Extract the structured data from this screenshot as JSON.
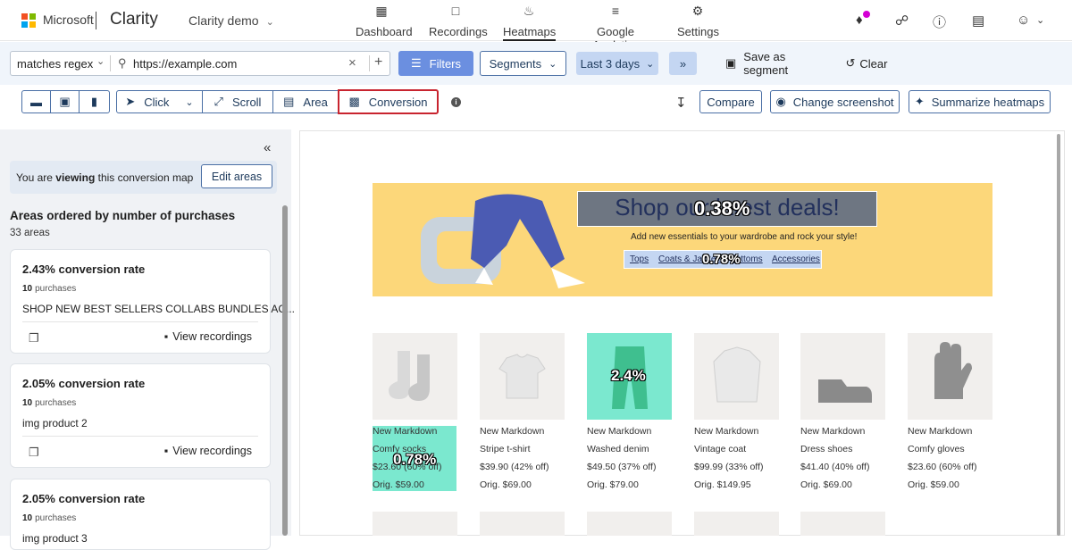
{
  "header": {
    "brand": "Microsoft",
    "product": "Clarity",
    "project": "Clarity demo",
    "tabs": [
      {
        "label": "Dashboard",
        "icon": "dashboard-icon"
      },
      {
        "label": "Recordings",
        "icon": "video-icon"
      },
      {
        "label": "Heatmaps",
        "icon": "flame-icon",
        "active": true
      },
      {
        "label": "Google Analytics",
        "icon": "analytics-icon"
      },
      {
        "label": "Settings",
        "icon": "gear-icon"
      }
    ],
    "right_icons": [
      "bell-icon",
      "share-icon",
      "help-icon",
      "document-icon",
      "account-icon"
    ]
  },
  "filterbar": {
    "match_type": "matches regex",
    "url_value": "https://example.com",
    "filters_label": "Filters",
    "segments_label": "Segments",
    "date_label": "Last 3 days",
    "save_segment_label": "Save as segment",
    "clear_label": "Clear"
  },
  "toolbar": {
    "click_label": "Click",
    "scroll_label": "Scroll",
    "area_label": "Area",
    "conversion_label": "Conversion",
    "compare_label": "Compare",
    "change_screenshot_label": "Change screenshot",
    "summarize_label": "Summarize heatmaps"
  },
  "sidebar": {
    "viewing_prefix": "You are ",
    "viewing_bold": "viewing",
    "viewing_suffix": " this conversion map",
    "edit_areas_label": "Edit areas",
    "areas_title": "Areas ordered by number of purchases",
    "areas_count": "33 areas",
    "view_recordings_label": "View recordings",
    "purchases_word": "purchases",
    "cards": [
      {
        "rate": "2.43% conversion rate",
        "purchases": "10",
        "name": "SHOP NEW BEST SELLERS COLLABS BUNDLES AC..."
      },
      {
        "rate": "2.05% conversion rate",
        "purchases": "10",
        "name": "img product 2"
      },
      {
        "rate": "2.05% conversion rate",
        "purchases": "10",
        "name": "img product 3"
      }
    ]
  },
  "preview": {
    "banner_title": "Shop our latest deals!",
    "banner_subtitle": "Add new essentials to your wardrobe and rock your style!",
    "banner_links": [
      "Tops",
      "Coats & Jackets",
      "Bottoms",
      "Accessories"
    ],
    "overlay_banner_title": "0.38%",
    "overlay_banner_links": "0.78%",
    "overlay_product_image": "2.4%",
    "overlay_product_text": "0.78%",
    "products": [
      {
        "tag": "New Markdown",
        "name": "Comfy socks",
        "price": "$23.60 (60% off)",
        "orig": "Orig. $59.00"
      },
      {
        "tag": "New Markdown",
        "name": "Stripe t-shirt",
        "price": "$39.90 (42% off)",
        "orig": "Orig. $69.00"
      },
      {
        "tag": "New Markdown",
        "name": "Washed denim",
        "price": "$49.50 (37% off)",
        "orig": "Orig. $79.00"
      },
      {
        "tag": "New Markdown",
        "name": "Vintage coat",
        "price": "$99.99 (33% off)",
        "orig": "Orig. $149.95"
      },
      {
        "tag": "New Markdown",
        "name": "Dress shoes",
        "price": "$41.40 (40% off)",
        "orig": "Orig. $69.00"
      },
      {
        "tag": "New Markdown",
        "name": "Comfy gloves",
        "price": "$23.60 (60% off)",
        "orig": "Orig. $59.00"
      }
    ]
  },
  "colors": {
    "accent": "#4a6fa5",
    "filters_button": "#6b8fe0",
    "banner": "#fcd77a",
    "highlight_green": "#6fe0c0",
    "highlight_teal": "#7be8cf",
    "overlay_gray": "#6e7682"
  }
}
